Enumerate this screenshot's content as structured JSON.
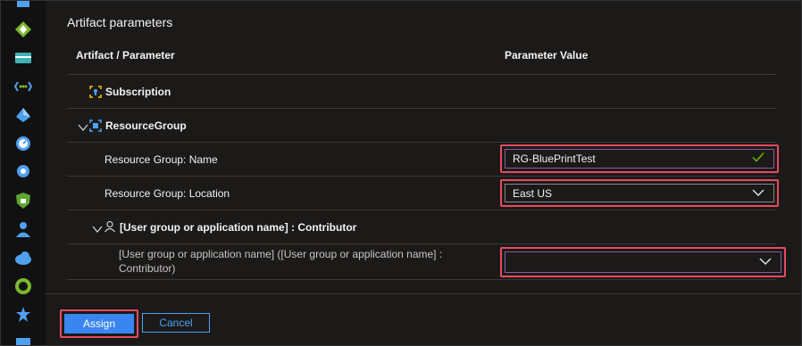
{
  "panel": {
    "title": "Artifact parameters"
  },
  "table": {
    "col_artifact": "Artifact / Parameter",
    "col_value": "Parameter Value"
  },
  "rows": {
    "subscription": "Subscription",
    "resource_group": "ResourceGroup",
    "rg_name_label": "Resource Group: Name",
    "rg_name_value": "RG-BluePrintTest",
    "rg_location_label": "Resource Group: Location",
    "rg_location_value": "East US",
    "contributor_group": "[User group or application name] : Contributor",
    "contributor_param_label": "[User group or application name] ([User group or application name] : Contributor)",
    "contributor_value": ""
  },
  "buttons": {
    "assign": "Assign",
    "cancel": "Cancel"
  },
  "colors": {
    "accent": "#3a86f0",
    "highlight": "#e84a5f",
    "valid": "#6bb700"
  }
}
